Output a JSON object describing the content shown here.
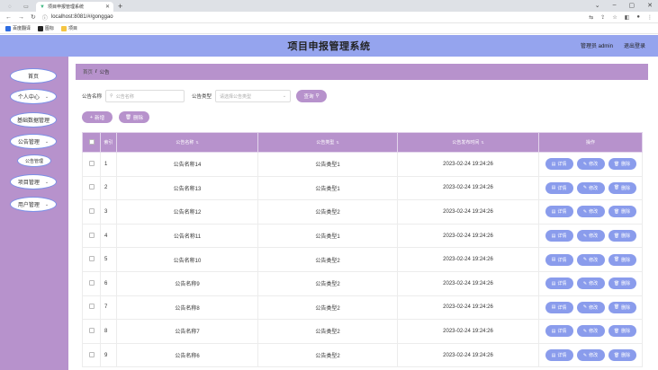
{
  "browser": {
    "tab_title": "项目申报管理系统",
    "url": "localhost:8081/#/gonggao",
    "bookmarks": [
      "百度翻译",
      "图标",
      "项目"
    ]
  },
  "header": {
    "title": "项目申报管理系统",
    "user": "管理员 admin",
    "logout": "退出登录"
  },
  "sidebar": {
    "items": [
      {
        "label": "首页",
        "chevron": false
      },
      {
        "label": "个人中心",
        "chevron": true
      },
      {
        "label": "基础数据管理",
        "chevron": false
      },
      {
        "label": "公告管理",
        "chevron": true
      },
      {
        "label": "公告管理",
        "chevron": false
      },
      {
        "label": "项目管理",
        "chevron": true
      },
      {
        "label": "用户管理",
        "chevron": true
      }
    ]
  },
  "breadcrumb": {
    "home": "首页",
    "sep": "/",
    "current": "公告"
  },
  "filter": {
    "name_label": "公告名称",
    "name_placeholder": "公告名称",
    "type_label": "公告类型",
    "type_placeholder": "请选择公告类型",
    "search_label": "查询"
  },
  "actions": {
    "add": "新增",
    "delete": "删除"
  },
  "table": {
    "columns": [
      "索引",
      "公告名称",
      "公告类型",
      "公告发布时间",
      "操作"
    ],
    "rows": [
      {
        "index": "1",
        "name": "公告名称14",
        "type": "公告类型1",
        "time": "2023-02-24 19:24:26"
      },
      {
        "index": "2",
        "name": "公告名称13",
        "type": "公告类型1",
        "time": "2023-02-24 19:24:26"
      },
      {
        "index": "3",
        "name": "公告名称12",
        "type": "公告类型2",
        "time": "2023-02-24 19:24:26"
      },
      {
        "index": "4",
        "name": "公告名称11",
        "type": "公告类型1",
        "time": "2023-02-24 19:24:26"
      },
      {
        "index": "5",
        "name": "公告名称10",
        "type": "公告类型2",
        "time": "2023-02-24 19:24:26"
      },
      {
        "index": "6",
        "name": "公告名称9",
        "type": "公告类型2",
        "time": "2023-02-24 19:24:26"
      },
      {
        "index": "7",
        "name": "公告名称8",
        "type": "公告类型2",
        "time": "2023-02-24 19:24:26"
      },
      {
        "index": "8",
        "name": "公告名称7",
        "type": "公告类型2",
        "time": "2023-02-24 19:24:26"
      },
      {
        "index": "9",
        "name": "公告名称6",
        "type": "公告类型2",
        "time": "2023-02-24 19:24:26"
      }
    ],
    "row_actions": [
      "详情",
      "修改",
      "删除"
    ]
  },
  "colors": {
    "header": "#95a4ee",
    "sidebar": "#b792cc",
    "button": "#8a9cec"
  }
}
